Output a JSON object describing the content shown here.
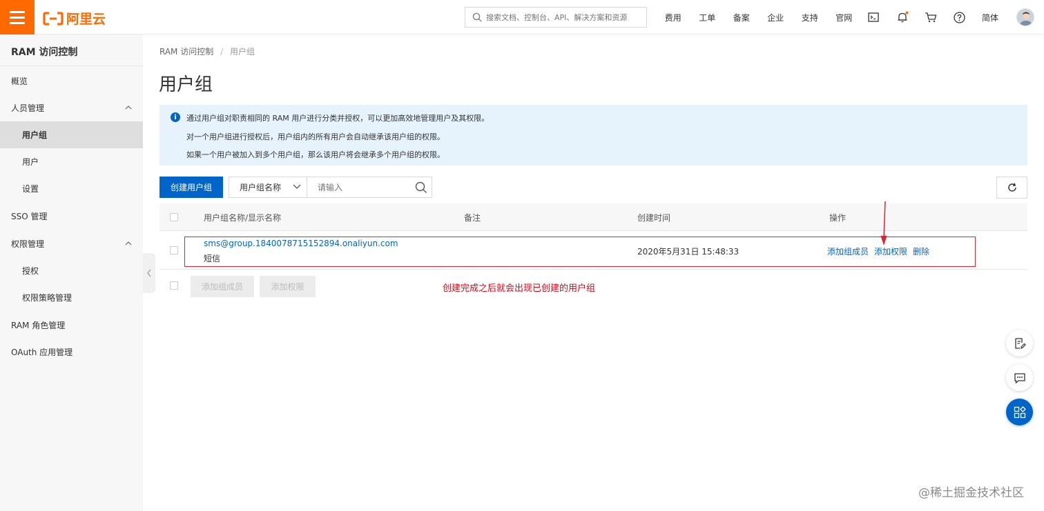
{
  "topbar": {
    "brand": "阿里云",
    "search_placeholder": "搜索文档、控制台、API、解决方案和资源",
    "nav": [
      "费用",
      "工单",
      "备案",
      "企业",
      "支持",
      "官网"
    ],
    "language": "简体",
    "icons": [
      "terminal-icon",
      "bell-icon",
      "cart-icon",
      "help-icon"
    ],
    "accent": "#ff6a00"
  },
  "sidebar": {
    "title": "RAM 访问控制",
    "items": [
      {
        "label": "概览",
        "level": 0
      },
      {
        "label": "人员管理",
        "level": 0,
        "expanded": true
      },
      {
        "label": "用户组",
        "level": 1,
        "active": true
      },
      {
        "label": "用户",
        "level": 1
      },
      {
        "label": "设置",
        "level": 1
      },
      {
        "label": "SSO 管理",
        "level": 0
      },
      {
        "label": "权限管理",
        "level": 0,
        "expanded": true
      },
      {
        "label": "授权",
        "level": 1
      },
      {
        "label": "权限策略管理",
        "level": 1
      },
      {
        "label": "RAM 角色管理",
        "level": 0
      },
      {
        "label": "OAuth 应用管理",
        "level": 0
      }
    ]
  },
  "breadcrumb": {
    "root": "RAM 访问控制",
    "separator": "/",
    "current": "用户组"
  },
  "page": {
    "title": "用户组"
  },
  "info": {
    "lines": [
      "通过用户组对职责相同的 RAM 用户进行分类并授权，可以更加高效地管理用户及其权限。",
      "对一个用户组进行授权后，用户组内的所有用户会自动继承该用户组的权限。",
      "如果一个用户被加入到多个用户组，那么该用户将会继承多个用户组的权限。"
    ]
  },
  "toolbar": {
    "create_label": "创建用户组",
    "filter_select": "用户组名称",
    "filter_placeholder": "请输入"
  },
  "table": {
    "columns": [
      "用户组名称/显示名称",
      "备注",
      "创建时间",
      "操作"
    ],
    "rows": [
      {
        "name": "sms@group.1840078715152894.onaliyun.com",
        "display_name": "短信",
        "remark": "",
        "created": "2020年5月31日 15:48:33",
        "actions": [
          "添加组成员",
          "添加权限",
          "删除"
        ]
      }
    ],
    "batch_actions": [
      "添加组成员",
      "添加权限"
    ]
  },
  "annotation": {
    "note": "创建完成之后就会出现已创建的用户组",
    "color": "#e60012"
  },
  "watermark": "@稀土掘金技术社区",
  "colors": {
    "primary": "#0064c8",
    "info_bg": "#e6f3fd"
  }
}
